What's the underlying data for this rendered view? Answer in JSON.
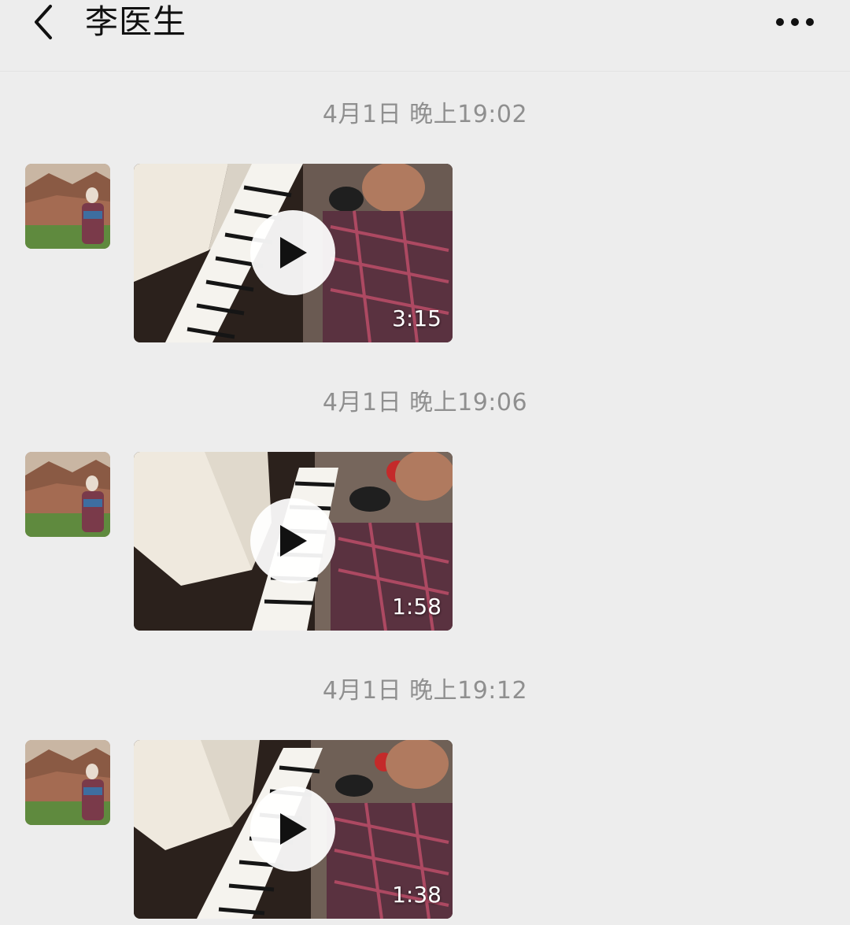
{
  "header": {
    "title": "李医生",
    "back_icon": "chevron-left-icon",
    "more_icon": "more-dots-icon"
  },
  "messages": [
    {
      "time": "4月1日 晚上19:02",
      "duration": "3:15"
    },
    {
      "time": "4月1日 晚上19:06",
      "duration": "1:58"
    },
    {
      "time": "4月1日 晚上19:12",
      "duration": "1:38"
    }
  ],
  "colors": {
    "background": "#ededed",
    "timestamp": "#8f8f8f",
    "title": "#111111"
  }
}
